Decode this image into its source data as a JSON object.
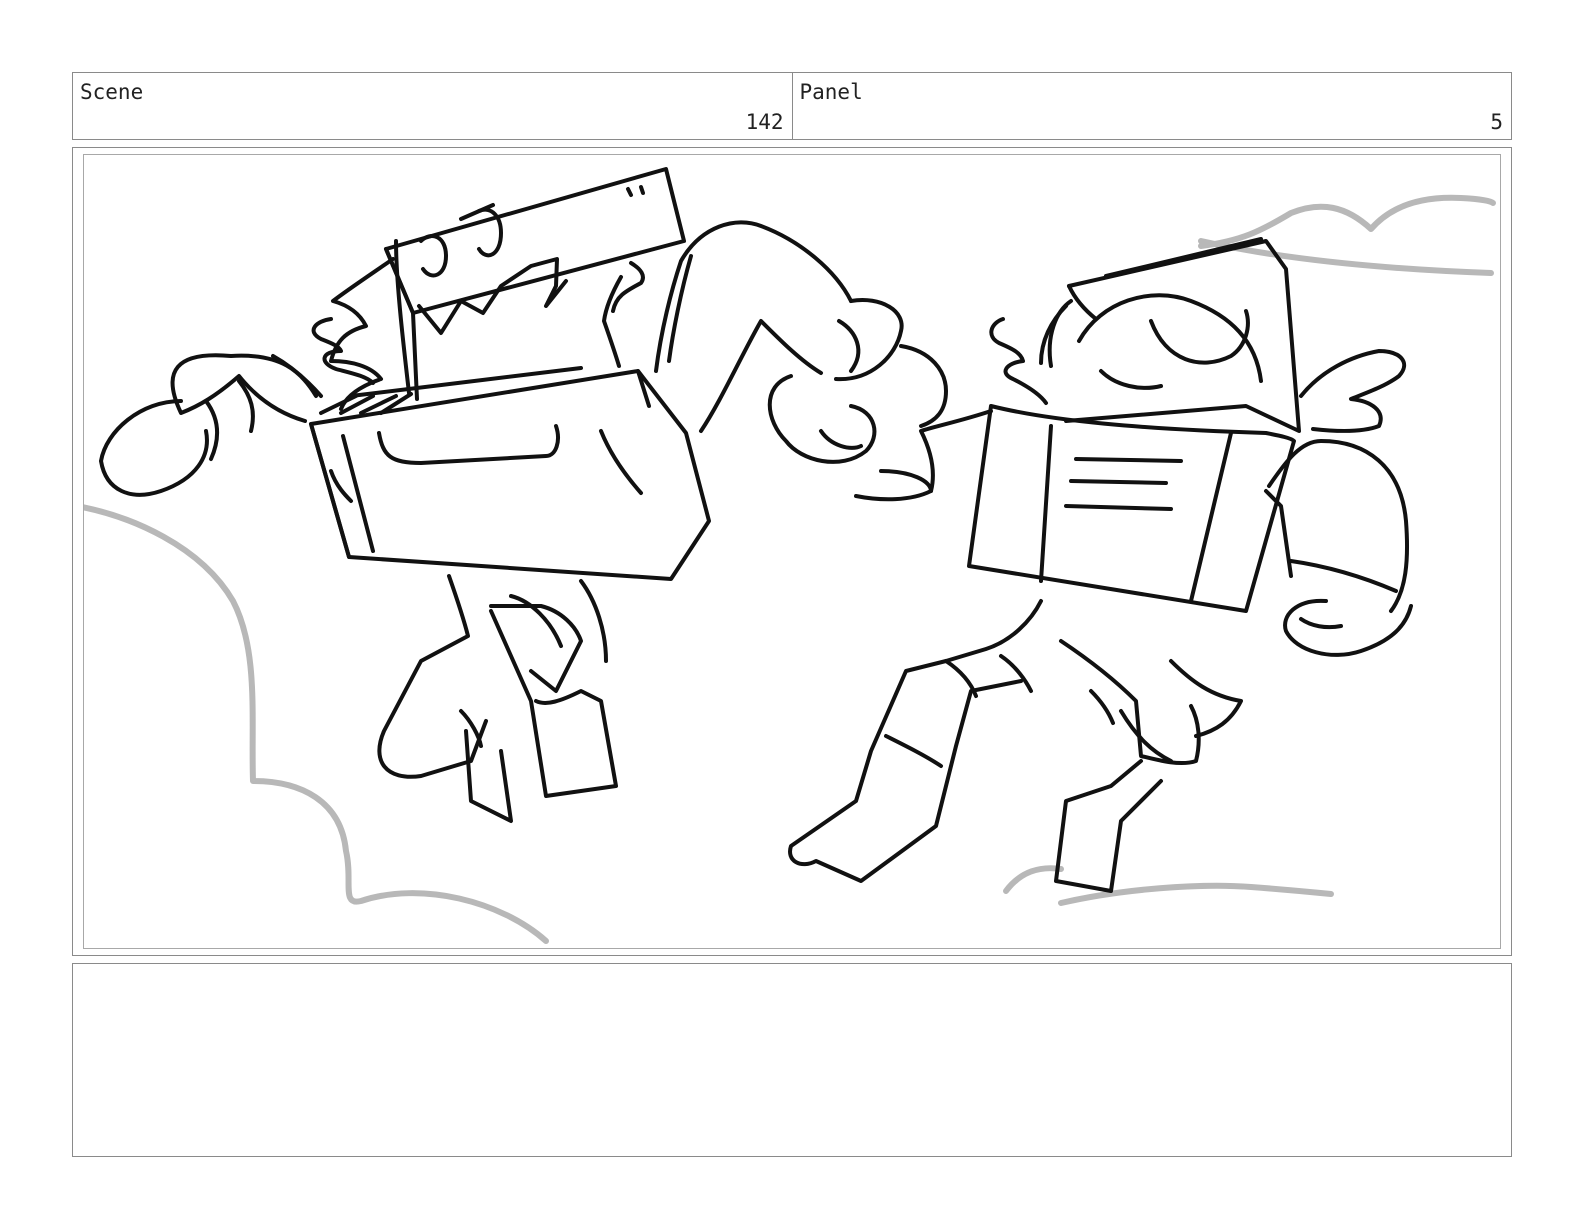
{
  "header": {
    "scene_label": "Scene",
    "scene_number": "142",
    "panel_label": "Panel",
    "panel_number": "5"
  },
  "frame": {
    "drawing": "storyboard-sketch"
  },
  "notes": {
    "text": ""
  }
}
